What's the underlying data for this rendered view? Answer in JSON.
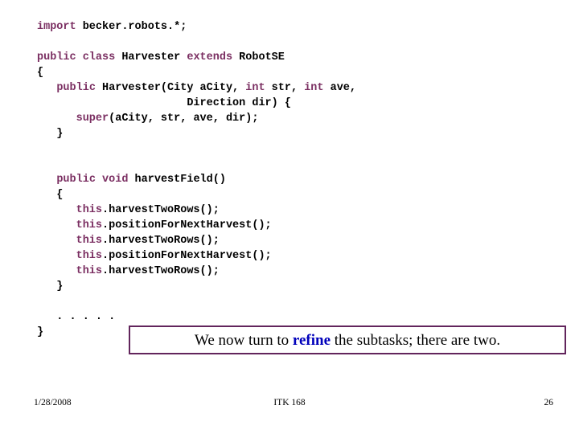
{
  "slide": {
    "code_lines": [
      [
        {
          "t": "import",
          "k": true
        },
        {
          "t": " becker.robots.*;",
          "k": false
        }
      ],
      [],
      [
        {
          "t": "public class",
          "k": true
        },
        {
          "t": " Harvester ",
          "k": false
        },
        {
          "t": "extends",
          "k": true
        },
        {
          "t": " RobotSE",
          "k": false
        }
      ],
      [
        {
          "t": "{",
          "k": false
        }
      ],
      [
        {
          "t": "   ",
          "k": false
        },
        {
          "t": "public",
          "k": true
        },
        {
          "t": " Harvester(City aCity, ",
          "k": false
        },
        {
          "t": "int",
          "k": true
        },
        {
          "t": " str, ",
          "k": false
        },
        {
          "t": "int",
          "k": true
        },
        {
          "t": " ave,",
          "k": false
        }
      ],
      [
        {
          "t": "                       Direction dir) {",
          "k": false
        }
      ],
      [
        {
          "t": "      ",
          "k": false
        },
        {
          "t": "super",
          "k": true
        },
        {
          "t": "(aCity, str, ave, dir);",
          "k": false
        }
      ],
      [
        {
          "t": "   }",
          "k": false
        }
      ],
      [],
      [],
      [
        {
          "t": "   ",
          "k": false
        },
        {
          "t": "public void",
          "k": true
        },
        {
          "t": " harvestField()",
          "k": false
        }
      ],
      [
        {
          "t": "   {",
          "k": false
        }
      ],
      [
        {
          "t": "      ",
          "k": false
        },
        {
          "t": "this",
          "k": true
        },
        {
          "t": ".harvestTwoRows();",
          "k": false
        }
      ],
      [
        {
          "t": "      ",
          "k": false
        },
        {
          "t": "this",
          "k": true
        },
        {
          "t": ".positionForNextHarvest();",
          "k": false
        }
      ],
      [
        {
          "t": "      ",
          "k": false
        },
        {
          "t": "this",
          "k": true
        },
        {
          "t": ".harvestTwoRows();",
          "k": false
        }
      ],
      [
        {
          "t": "      ",
          "k": false
        },
        {
          "t": "this",
          "k": true
        },
        {
          "t": ".positionForNextHarvest();",
          "k": false
        }
      ],
      [
        {
          "t": "      ",
          "k": false
        },
        {
          "t": "this",
          "k": true
        },
        {
          "t": ".harvestTwoRows();",
          "k": false
        }
      ],
      [
        {
          "t": "   }",
          "k": false
        }
      ],
      [],
      [
        {
          "t": "   . . . . .",
          "k": false
        }
      ],
      [
        {
          "t": "}",
          "k": false
        }
      ]
    ],
    "callout": {
      "before": "We now turn to ",
      "emphasis": "refine",
      "after": " the subtasks; there are two."
    },
    "footer": {
      "date": "1/28/2008",
      "course": "ITK 168",
      "page": "26"
    },
    "colors": {
      "keyword": "#7b2f62",
      "code_text": "#000000",
      "callout_border": "#62255c",
      "emphasis": "#0000bb",
      "background": "#ffffff"
    }
  }
}
